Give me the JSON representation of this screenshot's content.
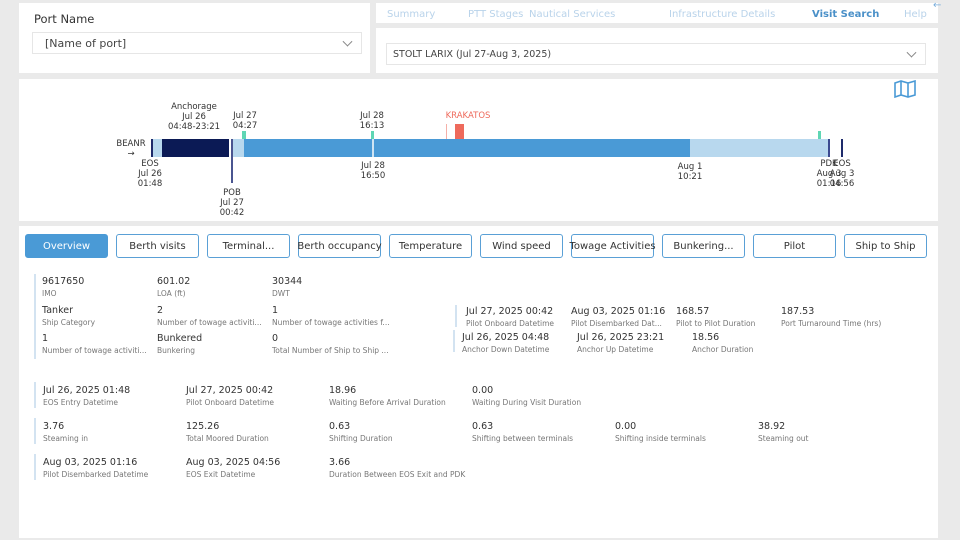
{
  "port_filter": {
    "label": "Port Name",
    "value": "[Name of port]"
  },
  "nav": {
    "items": [
      "Summary",
      "PTT Stages",
      "Nautical Services",
      "Infrastructure Details",
      "Visit Search",
      "Help"
    ],
    "active": "Visit Search"
  },
  "visit_select": {
    "value": "STOLT LARIX (Jul 27-Aug 3, 2025)"
  },
  "timeline": {
    "origin": "BEANR",
    "arrow": "→",
    "labels": {
      "anchorage": [
        "Anchorage",
        "Jul 26",
        "04:48-23:21"
      ],
      "jul27": [
        "Jul 27",
        "04:27"
      ],
      "jul28a": [
        "Jul 28",
        "16:13"
      ],
      "red": "KRAKATOS",
      "eos_in": [
        "EOS",
        "Jul 26",
        "01:48"
      ],
      "pob": [
        "POB",
        "Jul 27",
        "00:42"
      ],
      "jul28b": [
        "Jul 28",
        "16:50"
      ],
      "aug1": [
        "Aug 1",
        "10:21"
      ],
      "pdk": [
        "PDK",
        "Aug 3",
        "01:16"
      ],
      "eos_out": [
        "EOS",
        "Aug 3",
        "04:56"
      ]
    },
    "colors": {
      "anchorage": "#0b1a55",
      "berth": "#4a9ad6",
      "idle": "#b8d8ee",
      "tug": "#5fd6b4",
      "bunker": "#ee6a5c"
    }
  },
  "tabs": [
    "Overview",
    "Berth visits",
    "Terminal...",
    "Berth occupancy",
    "Temperature",
    "Wind speed",
    "Towage Activities",
    "Bunkering...",
    "Pilot",
    "Ship to Ship"
  ],
  "overview": {
    "row1": [
      {
        "v": "9617650",
        "l": "IMO"
      },
      {
        "v": "601.02",
        "l": "LOA (ft)"
      },
      {
        "v": "30344",
        "l": "DWT"
      }
    ],
    "row2": [
      {
        "v": "Tanker",
        "l": "Ship Category"
      },
      {
        "v": "2",
        "l": "Number of towage activiti..."
      },
      {
        "v": "1",
        "l": "Number of towage activities f..."
      }
    ],
    "row3": [
      {
        "v": "1",
        "l": "Number of towage activiti..."
      },
      {
        "v": "Bunkered",
        "l": "Bunkering"
      },
      {
        "v": "0",
        "l": "Total Number of Ship to Ship ..."
      }
    ],
    "pilot": [
      {
        "v": "Jul 27, 2025 00:42",
        "l": "Pilot Onboard Datetime"
      },
      {
        "v": "Aug 03, 2025 01:16",
        "l": "Pilot Disembarked Dat..."
      },
      {
        "v": "168.57",
        "l": "Pilot to Pilot Duration"
      },
      {
        "v": "187.53",
        "l": "Port Turnaround Time (hrs)"
      }
    ],
    "anchor": [
      {
        "v": "Jul 26, 2025 04:48",
        "l": "Anchor Down Datetime"
      },
      {
        "v": "Jul 26, 2025 23:21",
        "l": "Anchor Up Datetime"
      },
      {
        "v": "18.56",
        "l": "Anchor Duration"
      }
    ],
    "s1": [
      {
        "v": "Jul 26, 2025 01:48",
        "l": "EOS Entry Datetime"
      },
      {
        "v": "Jul 27, 2025 00:42",
        "l": "Pilot Onboard Datetime"
      },
      {
        "v": "18.96",
        "l": "Waiting Before Arrival Duration"
      },
      {
        "v": "0.00",
        "l": "Waiting During Visit Duration"
      }
    ],
    "s2": [
      {
        "v": "3.76",
        "l": "Steaming in"
      },
      {
        "v": "125.26",
        "l": "Total Moored Duration"
      },
      {
        "v": "0.63",
        "l": "Shifting Duration"
      },
      {
        "v": "0.63",
        "l": "Shifting between terminals"
      },
      {
        "v": "0.00",
        "l": "Shifting inside terminals"
      },
      {
        "v": "38.92",
        "l": "Steaming out"
      }
    ],
    "s3": [
      {
        "v": "Aug 03, 2025 01:16",
        "l": "Pilot Disembarked Datetime"
      },
      {
        "v": "Aug 03, 2025 04:56",
        "l": "EOS Exit Datetime"
      },
      {
        "v": "3.66",
        "l": "Duration Between EOS Exit and PDK"
      }
    ]
  }
}
